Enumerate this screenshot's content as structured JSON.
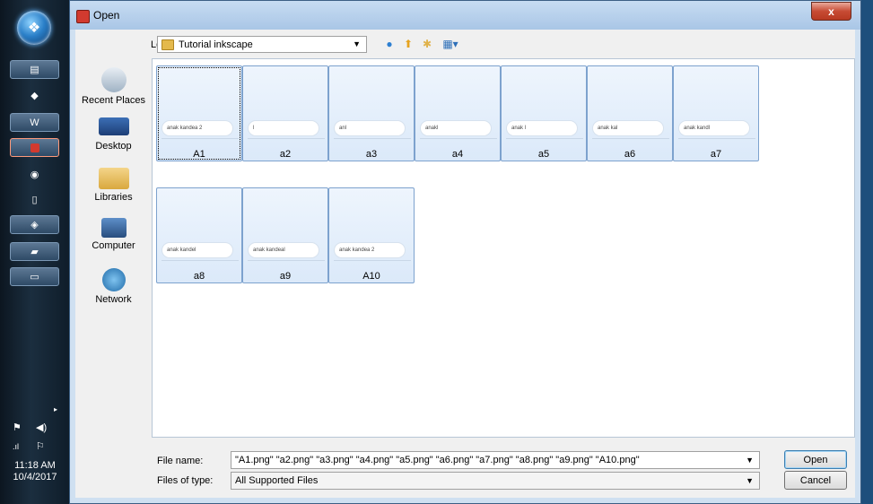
{
  "taskbar": {
    "clock_time": "11:18 AM",
    "clock_date": "10/4/2017"
  },
  "dialog": {
    "title": "Open",
    "close_label": "x",
    "look_in_label": "Look in:",
    "look_in_value": "Tutorial inkscape",
    "places": [
      {
        "label": "Recent Places",
        "icon": "recent-places-icon"
      },
      {
        "label": "Desktop",
        "icon": "desktop-icon"
      },
      {
        "label": "Libraries",
        "icon": "libraries-icon"
      },
      {
        "label": "Computer",
        "icon": "computer-icon"
      },
      {
        "label": "Network",
        "icon": "network-icon"
      }
    ],
    "files": [
      {
        "name": "A1",
        "preview": "anak kandea 2"
      },
      {
        "name": "a2",
        "preview": "l"
      },
      {
        "name": "a3",
        "preview": "anl"
      },
      {
        "name": "a4",
        "preview": "anakl"
      },
      {
        "name": "a5",
        "preview": "anak l"
      },
      {
        "name": "a6",
        "preview": "anak kal"
      },
      {
        "name": "a7",
        "preview": "anak kandl"
      },
      {
        "name": "a8",
        "preview": "anak kandel"
      },
      {
        "name": "a9",
        "preview": "anak kandeal"
      },
      {
        "name": "A10",
        "preview": "anak kandea 2"
      }
    ],
    "file_name_label": "File name:",
    "file_name_value": "\"A1.png\" \"a2.png\" \"a3.png\" \"a4.png\" \"a5.png\" \"a6.png\" \"a7.png\" \"a8.png\" \"a9.png\" \"A10.png\"",
    "file_type_label": "Files of type:",
    "file_type_value": "All Supported Files",
    "open_label": "Open",
    "cancel_label": "Cancel"
  }
}
